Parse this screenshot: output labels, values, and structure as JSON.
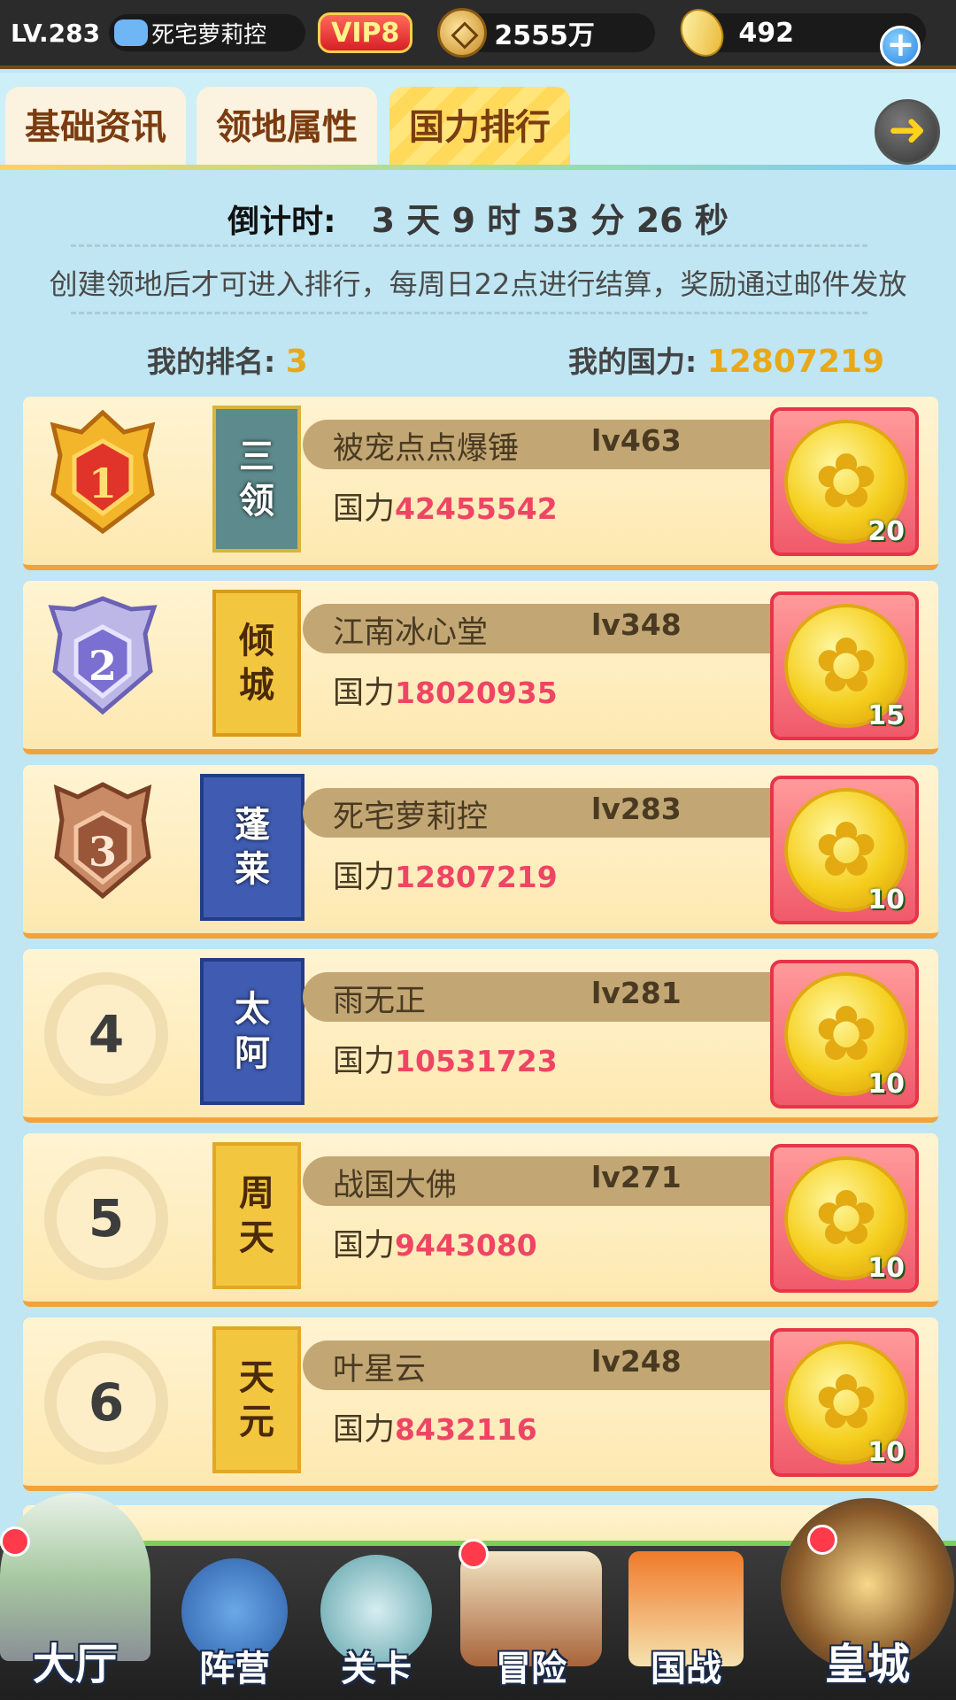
{
  "topbar": {
    "level": "LV.283",
    "player_name": "死宅萝莉控",
    "vip": "VIP8",
    "coins": "2555万",
    "gold": "492",
    "plus_icon": "plus-icon"
  },
  "tabs": [
    {
      "label": "基础资讯",
      "active": false
    },
    {
      "label": "领地属性",
      "active": false
    },
    {
      "label": "国力排行",
      "active": true
    }
  ],
  "back_icon": "arrow-left-icon",
  "info": {
    "countdown_label": "倒计时:",
    "countdown_value": "3 天 9 时 53 分 26 秒",
    "notice": "创建领地后才可进入排行，每周日22点进行结算，奖励通过邮件发放",
    "my_rank_label": "我的排名:",
    "my_rank_value": "3",
    "my_power_label": "我的国力:",
    "my_power_value": "12807219"
  },
  "ranking": [
    {
      "rank": "1",
      "banner": [
        "三",
        "领"
      ],
      "name": "被宠点点爆锤",
      "level": "lv463",
      "power_label": "国力",
      "power": "42455542",
      "reward_count": "20"
    },
    {
      "rank": "2",
      "banner": [
        "倾",
        "城"
      ],
      "name": "江南冰心堂",
      "level": "lv348",
      "power_label": "国力",
      "power": "18020935",
      "reward_count": "15"
    },
    {
      "rank": "3",
      "banner": [
        "蓬",
        "莱"
      ],
      "name": "死宅萝莉控",
      "level": "lv283",
      "power_label": "国力",
      "power": "12807219",
      "reward_count": "10"
    },
    {
      "rank": "4",
      "banner": [
        "太",
        "阿"
      ],
      "name": "雨无正",
      "level": "lv281",
      "power_label": "国力",
      "power": "10531723",
      "reward_count": "10"
    },
    {
      "rank": "5",
      "banner": [
        "周",
        "天"
      ],
      "name": "战国大佛",
      "level": "lv271",
      "power_label": "国力",
      "power": "9443080",
      "reward_count": "10"
    },
    {
      "rank": "6",
      "banner": [
        "天",
        "元"
      ],
      "name": "叶星云",
      "level": "lv248",
      "power_label": "国力",
      "power": "8432116",
      "reward_count": "10"
    }
  ],
  "bottom_nav": [
    {
      "label": "大厅",
      "icon": "castle-icon",
      "badge": true
    },
    {
      "label": "阵营",
      "icon": "scroll-icon",
      "badge": false
    },
    {
      "label": "关卡",
      "icon": "crossed-swords-icon",
      "badge": false
    },
    {
      "label": "冒险",
      "icon": "ship-icon",
      "badge": true
    },
    {
      "label": "国战",
      "icon": "war-flags-icon",
      "badge": false
    },
    {
      "label": "皇城",
      "icon": "palace-icon",
      "badge": true
    }
  ]
}
